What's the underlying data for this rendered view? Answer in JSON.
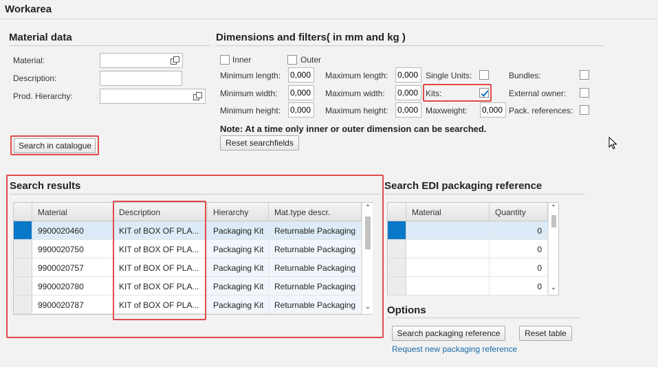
{
  "workarea": {
    "title": "Workarea"
  },
  "material_data": {
    "title": "Material data",
    "material_label": "Material:",
    "material_value": "",
    "description_label": "Description:",
    "description_value": "",
    "prod_hierarchy_label": "Prod. Hierarchy:",
    "prod_hierarchy_value": "",
    "search_button": "Search in catalogue"
  },
  "dimensions": {
    "title": "Dimensions and filters( in mm and kg )",
    "inner_label": "Inner",
    "inner_checked": false,
    "outer_label": "Outer",
    "outer_checked": false,
    "min_length_label": "Minimum length:",
    "min_length_value": "0,000",
    "min_width_label": "Minimum width:",
    "min_width_value": "0,000",
    "min_height_label": "Minimum height:",
    "min_height_value": "0,000",
    "max_length_label": "Maximum length:",
    "max_length_value": "0,000",
    "max_width_label": "Maximum width:",
    "max_width_value": "0,000",
    "max_height_label": "Maximum height:",
    "max_height_value": "0,000",
    "single_units_label": "Single Units:",
    "single_units_checked": false,
    "kits_label": "Kits:",
    "kits_checked": true,
    "maxweight_label": "Maxweight:",
    "maxweight_value": "0,000",
    "bundles_label": "Bundles:",
    "bundles_checked": false,
    "external_owner_label": "External owner:",
    "external_owner_checked": false,
    "pack_references_label": "Pack. references:",
    "pack_references_checked": false,
    "note": "Note: At a time only inner or outer dimension can be searched.",
    "reset_button": "Reset searchfields"
  },
  "search_results": {
    "title": "Search results",
    "columns": [
      "Material",
      "Description",
      "Hierarchy",
      "Mat.type descr."
    ],
    "rows": [
      {
        "material": "9900020460",
        "description": "KIT of BOX OF PLA...",
        "hierarchy": "Packaging Kit",
        "mat_type": "Returnable Packaging"
      },
      {
        "material": "9900020750",
        "description": "KIT of BOX OF PLA...",
        "hierarchy": "Packaging Kit",
        "mat_type": "Returnable Packaging"
      },
      {
        "material": "9900020757",
        "description": "KIT of BOX OF PLA...",
        "hierarchy": "Packaging Kit",
        "mat_type": "Returnable Packaging"
      },
      {
        "material": "9900020780",
        "description": "KIT of BOX OF PLA...",
        "hierarchy": "Packaging Kit",
        "mat_type": "Returnable Packaging"
      },
      {
        "material": "9900020787",
        "description": "KIT of BOX OF PLA...",
        "hierarchy": "Packaging Kit",
        "mat_type": "Returnable Packaging"
      }
    ]
  },
  "edi": {
    "title": "Search EDI packaging reference",
    "columns": [
      "Material",
      "Quantity"
    ],
    "rows": [
      {
        "material": "",
        "quantity": "0"
      },
      {
        "material": "",
        "quantity": "0"
      },
      {
        "material": "",
        "quantity": "0"
      },
      {
        "material": "",
        "quantity": "0"
      }
    ]
  },
  "options": {
    "title": "Options",
    "search_button": "Search packaging reference",
    "reset_button": "Reset table",
    "request_link": "Request new packaging reference"
  },
  "colors": {
    "highlight_box": "#e04a4a",
    "selected_row": "#dcebf7",
    "row_marker": "#0a78c8",
    "link": "#1a6aa6"
  }
}
